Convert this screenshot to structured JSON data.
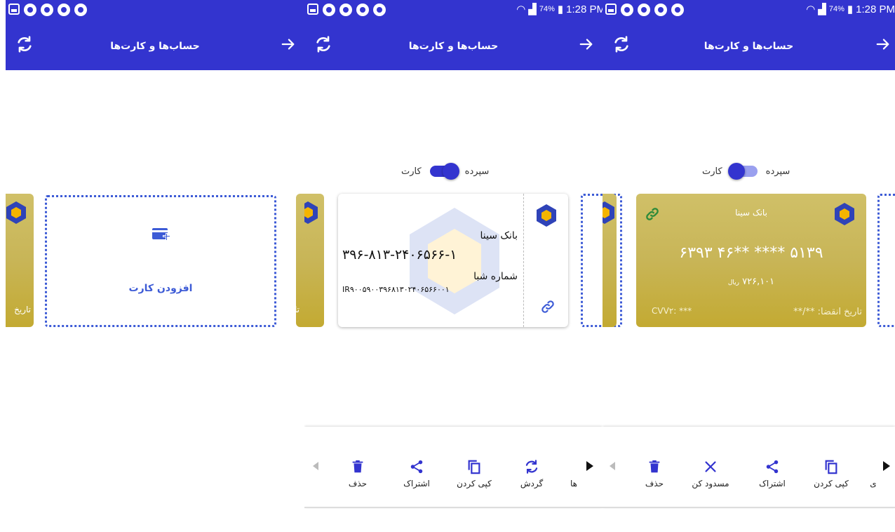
{
  "status": {
    "battery": "74%",
    "time": "1:28 PM"
  },
  "appbar": {
    "title": "حساب‌ها و کارت‌ها"
  },
  "toggle": {
    "left_label": "کارت",
    "right_label": "سپرده"
  },
  "panel1": {
    "add_card_label": "افزودن کارت",
    "peek_left_text": "تاریخ",
    "peek_right_text": "تا"
  },
  "panel2": {
    "deposit": {
      "bank": "بانک سینا",
      "number": "۳۹۶-۸۱۳-۲۴۰۶۵۶۶-۱",
      "sheba_label": "شماره شبا",
      "sheba_value": "IR۹۰۰۵۹۰۰۳۹۶۸۱۳۰۲۴۰۶۵۶۶۰۰۱"
    },
    "peek_right_text": "تا",
    "actions": [
      {
        "label": "حذف",
        "icon": "trash-icon"
      },
      {
        "label": "اشتراک",
        "icon": "share-icon"
      },
      {
        "label": "کپی کردن",
        "icon": "copy-icon"
      },
      {
        "label": "گردش",
        "icon": "refresh-icon"
      },
      {
        "label": "ها",
        "icon": ""
      }
    ]
  },
  "panel3": {
    "card": {
      "bank": "بانک سینا",
      "number": "۶۳۹۳ ۴۶** **** ۵۱۳۹",
      "balance": "۷۲۶,۱۰۱",
      "currency": "ریال",
      "cvv": "CVV۲: ***",
      "expiry": "تاریخ انقضا: **/**"
    },
    "actions": [
      {
        "label": "حذف",
        "icon": "trash-icon"
      },
      {
        "label": "مسدود کن",
        "icon": "close-icon"
      },
      {
        "label": "اشتراک",
        "icon": "share-icon"
      },
      {
        "label": "کپی کردن",
        "icon": "copy-icon"
      },
      {
        "label": "ی",
        "icon": ""
      }
    ]
  },
  "colors": {
    "primary": "#3334cf",
    "gold": "#c8b557",
    "dotted": "#3d5bd6"
  }
}
